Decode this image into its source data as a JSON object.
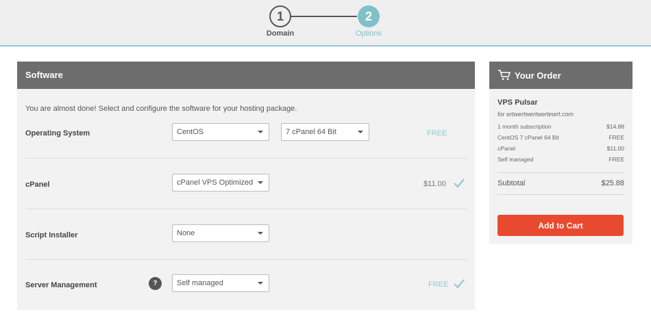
{
  "steps": [
    {
      "number": "1",
      "label": "Domain"
    },
    {
      "number": "2",
      "label": "Options"
    }
  ],
  "software": {
    "title": "Software",
    "intro": "You are almost done! Select and configure the software for your hosting package.",
    "rows": [
      {
        "label": "Operating System",
        "select1": "CentOS",
        "select2": "7 cPanel 64 Bit",
        "price": "FREE",
        "checked": false
      },
      {
        "label": "cPanel",
        "select1": "cPanel VPS Optimized",
        "price": "$11.00",
        "checked": true
      },
      {
        "label": "Script Installer",
        "select1": "None",
        "price": "",
        "checked": false
      },
      {
        "label": "Server Management",
        "help": "?",
        "select1": "Self managed",
        "price": "FREE",
        "checked": true
      }
    ]
  },
  "order": {
    "title": "Your Order",
    "product": "VPS Pulsar",
    "domain": "for ertwertwertwertewrt.com",
    "lines": [
      {
        "name": "1 month subscription",
        "price": "$14.88"
      },
      {
        "name": "CentOS 7 cPanel 64 Bit",
        "price": "FREE"
      },
      {
        "name": "cPanel",
        "price": "$11.00"
      },
      {
        "name": "Self managed",
        "price": "FREE"
      }
    ],
    "subtotal_label": "Subtotal",
    "subtotal_value": "$25.88",
    "cart_button": "Add to Cart"
  },
  "colors": {
    "accent": "#7fc1c7",
    "cart": "#e84a2f",
    "header": "#6d6d6d"
  },
  "icons": {
    "cart": "shopping-cart-icon",
    "check": "check-icon",
    "help": "question-icon"
  }
}
